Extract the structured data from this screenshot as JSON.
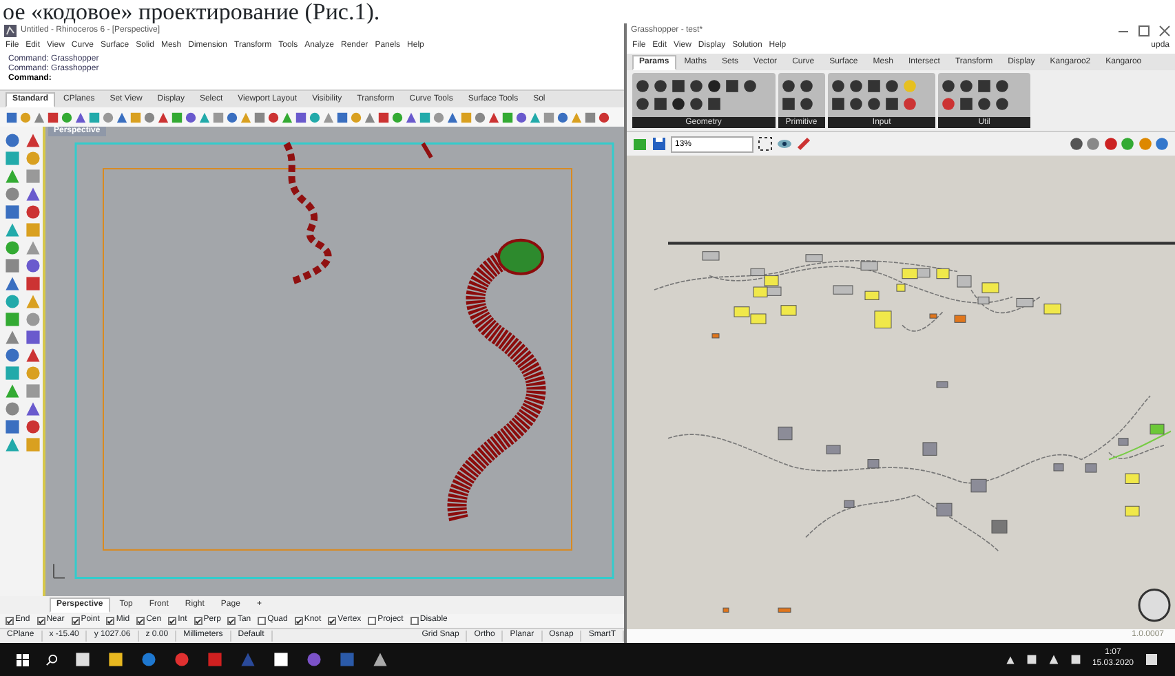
{
  "caption": "ое «кодовое» проектирование (Рис.1).",
  "rhino": {
    "title": "Untitled - Rhinoceros 6 - [Perspective]",
    "menu": [
      "File",
      "Edit",
      "View",
      "Curve",
      "Surface",
      "Solid",
      "Mesh",
      "Dimension",
      "Transform",
      "Tools",
      "Analyze",
      "Render",
      "Panels",
      "Help"
    ],
    "command_history": [
      "Command: Grasshopper",
      "Command: Grasshopper"
    ],
    "command_prompt": "Command:",
    "tabs": [
      {
        "label": "Standard",
        "selected": true
      },
      {
        "label": "CPlanes",
        "selected": false
      },
      {
        "label": "Set View",
        "selected": false
      },
      {
        "label": "Display",
        "selected": false
      },
      {
        "label": "Select",
        "selected": false
      },
      {
        "label": "Viewport Layout",
        "selected": false
      },
      {
        "label": "Visibility",
        "selected": false
      },
      {
        "label": "Transform",
        "selected": false
      },
      {
        "label": "Curve Tools",
        "selected": false
      },
      {
        "label": "Surface Tools",
        "selected": false
      },
      {
        "label": "Sol",
        "selected": false
      }
    ],
    "viewport_label": "Perspective",
    "viewport_tabs": [
      {
        "label": "Perspective",
        "selected": true
      },
      {
        "label": "Top",
        "selected": false
      },
      {
        "label": "Front",
        "selected": false
      },
      {
        "label": "Right",
        "selected": false
      },
      {
        "label": "Page",
        "selected": false
      },
      {
        "label": "+",
        "selected": false
      }
    ],
    "osnaps": [
      {
        "label": "End",
        "checked": true
      },
      {
        "label": "Near",
        "checked": true
      },
      {
        "label": "Point",
        "checked": true
      },
      {
        "label": "Mid",
        "checked": true
      },
      {
        "label": "Cen",
        "checked": true
      },
      {
        "label": "Int",
        "checked": true
      },
      {
        "label": "Perp",
        "checked": true
      },
      {
        "label": "Tan",
        "checked": true
      },
      {
        "label": "Quad",
        "checked": false
      },
      {
        "label": "Knot",
        "checked": true
      },
      {
        "label": "Vertex",
        "checked": true
      },
      {
        "label": "Project",
        "checked": false
      },
      {
        "label": "Disable",
        "checked": false
      }
    ],
    "status": [
      "CPlane",
      "x -15.40",
      "y 1027.06",
      "z 0.00",
      "Millimeters",
      "Default"
    ],
    "status_toggles": [
      "Grid Snap",
      "Ortho",
      "Planar",
      "Osnap",
      "SmartT"
    ]
  },
  "grasshopper": {
    "title": "Grasshopper - test*",
    "menu": [
      "File",
      "Edit",
      "View",
      "Display",
      "Solution",
      "Help"
    ],
    "menu_right": "upda",
    "tabs": [
      {
        "label": "Params",
        "selected": true
      },
      {
        "label": "Maths",
        "selected": false
      },
      {
        "label": "Sets",
        "selected": false
      },
      {
        "label": "Vector",
        "selected": false
      },
      {
        "label": "Curve",
        "selected": false
      },
      {
        "label": "Surface",
        "selected": false
      },
      {
        "label": "Mesh",
        "selected": false
      },
      {
        "label": "Intersect",
        "selected": false
      },
      {
        "label": "Transform",
        "selected": false
      },
      {
        "label": "Display",
        "selected": false
      },
      {
        "label": "Kangaroo2",
        "selected": false
      },
      {
        "label": "Kangaroo",
        "selected": false
      }
    ],
    "panels": [
      "Geometry",
      "Primitive",
      "Input",
      "Util"
    ],
    "zoom": "13%",
    "status": "1.0.0007"
  },
  "taskbar": {
    "time": "1:07",
    "date": "15.03.2020"
  }
}
